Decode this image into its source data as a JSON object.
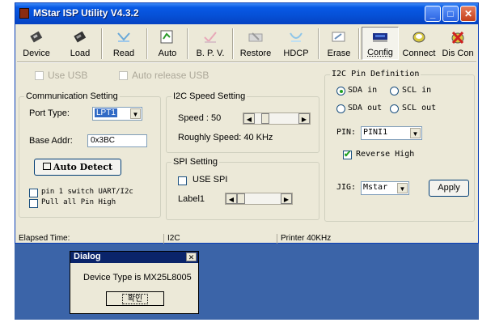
{
  "window": {
    "title": "MStar ISP Utility V4.3.2"
  },
  "toolbar": {
    "buttons": [
      {
        "label": "Device",
        "icon": "device-icon"
      },
      {
        "label": "Load",
        "icon": "load-icon"
      },
      {
        "label": "Read",
        "icon": "read-icon"
      },
      {
        "label": "Auto",
        "icon": "auto-icon"
      },
      {
        "label": "B. P. V.",
        "icon": "bpv-icon"
      },
      {
        "label": "Restore",
        "icon": "restore-icon"
      },
      {
        "label": "HDCP",
        "icon": "hdcp-icon"
      },
      {
        "label": "Erase",
        "icon": "erase-icon"
      },
      {
        "label": "Config",
        "icon": "config-icon"
      },
      {
        "label": "Connect",
        "icon": "connect-icon"
      },
      {
        "label": "Dis Con",
        "icon": "disconnect-icon"
      }
    ]
  },
  "options": {
    "use_usb": "Use USB",
    "auto_release_usb": "Auto release USB"
  },
  "communication": {
    "title": "Communication Setting",
    "port_type_label": "Port Type:",
    "port_type_value": "LPT1",
    "base_addr_label": "Base Addr:",
    "base_addr_value": "0x3BC",
    "auto_detect": "Auto Detect",
    "pin1_switch": "pin 1 switch UART/I2c",
    "pull_all": "Pull all Pin High"
  },
  "i2c_speed": {
    "title": "I2C Speed Setting",
    "speed_label": "Speed : 50",
    "roughly": "Roughly Speed: 40 KHz"
  },
  "spi": {
    "title": "SPI Setting",
    "use_spi": "USE SPI",
    "label1": "Label1"
  },
  "pin_def": {
    "title": "I2C Pin Definition",
    "sda_in": "SDA in",
    "scl_in": "SCL in",
    "sda_out": "SDA out",
    "scl_out": "SCL out",
    "pin_label": "PIN:",
    "pin_value": "PINI1",
    "reverse_high": "Reverse High",
    "jig_label": "JIG:",
    "jig_value": "Mstar",
    "apply": "Apply"
  },
  "status": {
    "elapsed": "Elapsed Time:",
    "bus": "I2C",
    "printer": "Printer  40KHz"
  },
  "dialog": {
    "title": "Dialog",
    "message": "Device Type is MX25L8005",
    "ok": "확인"
  },
  "colors": {
    "titlebar": "#0650d6",
    "window_bg": "#ece9d8",
    "desktop": "#3b64a8",
    "dialog_title": "#0a246a"
  }
}
